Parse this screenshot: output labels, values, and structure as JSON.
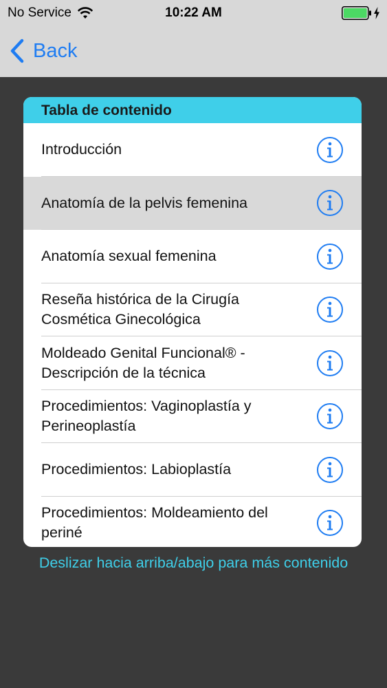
{
  "status_bar": {
    "carrier": "No Service",
    "time": "10:22 AM",
    "wifi_icon": "wifi-icon",
    "battery_icon": "battery-icon",
    "battery_color": "#4cd964"
  },
  "nav": {
    "back_label": "Back",
    "back_icon": "chevron-left-icon",
    "accent_color": "#1e7cf2"
  },
  "toc": {
    "title": "Tabla de contenido",
    "header_color": "#3fcfe9",
    "items": [
      {
        "label": "Introducción",
        "selected": false
      },
      {
        "label": "Anatomía de la pelvis femenina",
        "selected": true
      },
      {
        "label": "Anatomía sexual femenina",
        "selected": false
      },
      {
        "label": "Reseña histórica de la Cirugía Cosmética Ginecológica",
        "selected": false
      },
      {
        "label": "Moldeado Genital Funcional® - Descripción de la técnica",
        "selected": false
      },
      {
        "label": "Procedimientos: Vaginoplastía y Perineoplastía",
        "selected": false
      },
      {
        "label": "Procedimientos: Labioplastía",
        "selected": false
      },
      {
        "label": "Procedimientos: Moldeamiento del periné",
        "selected": false
      }
    ],
    "item_icon": "info-icon"
  },
  "scroll_hint": "Deslizar hacia arriba/abajo para más contenido"
}
